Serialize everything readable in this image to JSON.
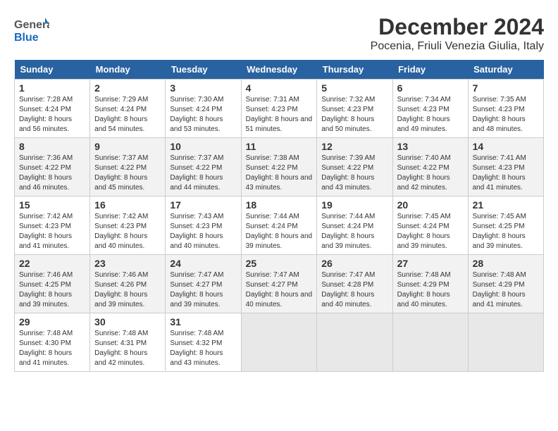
{
  "header": {
    "logo_general": "General",
    "logo_blue": "Blue",
    "month": "December 2024",
    "location": "Pocenia, Friuli Venezia Giulia, Italy"
  },
  "columns": [
    "Sunday",
    "Monday",
    "Tuesday",
    "Wednesday",
    "Thursday",
    "Friday",
    "Saturday"
  ],
  "weeks": [
    [
      {
        "day": "1",
        "sunrise": "Sunrise: 7:28 AM",
        "sunset": "Sunset: 4:24 PM",
        "daylight": "Daylight: 8 hours and 56 minutes."
      },
      {
        "day": "2",
        "sunrise": "Sunrise: 7:29 AM",
        "sunset": "Sunset: 4:24 PM",
        "daylight": "Daylight: 8 hours and 54 minutes."
      },
      {
        "day": "3",
        "sunrise": "Sunrise: 7:30 AM",
        "sunset": "Sunset: 4:24 PM",
        "daylight": "Daylight: 8 hours and 53 minutes."
      },
      {
        "day": "4",
        "sunrise": "Sunrise: 7:31 AM",
        "sunset": "Sunset: 4:23 PM",
        "daylight": "Daylight: 8 hours and 51 minutes."
      },
      {
        "day": "5",
        "sunrise": "Sunrise: 7:32 AM",
        "sunset": "Sunset: 4:23 PM",
        "daylight": "Daylight: 8 hours and 50 minutes."
      },
      {
        "day": "6",
        "sunrise": "Sunrise: 7:34 AM",
        "sunset": "Sunset: 4:23 PM",
        "daylight": "Daylight: 8 hours and 49 minutes."
      },
      {
        "day": "7",
        "sunrise": "Sunrise: 7:35 AM",
        "sunset": "Sunset: 4:23 PM",
        "daylight": "Daylight: 8 hours and 48 minutes."
      }
    ],
    [
      {
        "day": "8",
        "sunrise": "Sunrise: 7:36 AM",
        "sunset": "Sunset: 4:22 PM",
        "daylight": "Daylight: 8 hours and 46 minutes."
      },
      {
        "day": "9",
        "sunrise": "Sunrise: 7:37 AM",
        "sunset": "Sunset: 4:22 PM",
        "daylight": "Daylight: 8 hours and 45 minutes."
      },
      {
        "day": "10",
        "sunrise": "Sunrise: 7:37 AM",
        "sunset": "Sunset: 4:22 PM",
        "daylight": "Daylight: 8 hours and 44 minutes."
      },
      {
        "day": "11",
        "sunrise": "Sunrise: 7:38 AM",
        "sunset": "Sunset: 4:22 PM",
        "daylight": "Daylight: 8 hours and 43 minutes."
      },
      {
        "day": "12",
        "sunrise": "Sunrise: 7:39 AM",
        "sunset": "Sunset: 4:22 PM",
        "daylight": "Daylight: 8 hours and 43 minutes."
      },
      {
        "day": "13",
        "sunrise": "Sunrise: 7:40 AM",
        "sunset": "Sunset: 4:22 PM",
        "daylight": "Daylight: 8 hours and 42 minutes."
      },
      {
        "day": "14",
        "sunrise": "Sunrise: 7:41 AM",
        "sunset": "Sunset: 4:23 PM",
        "daylight": "Daylight: 8 hours and 41 minutes."
      }
    ],
    [
      {
        "day": "15",
        "sunrise": "Sunrise: 7:42 AM",
        "sunset": "Sunset: 4:23 PM",
        "daylight": "Daylight: 8 hours and 41 minutes."
      },
      {
        "day": "16",
        "sunrise": "Sunrise: 7:42 AM",
        "sunset": "Sunset: 4:23 PM",
        "daylight": "Daylight: 8 hours and 40 minutes."
      },
      {
        "day": "17",
        "sunrise": "Sunrise: 7:43 AM",
        "sunset": "Sunset: 4:23 PM",
        "daylight": "Daylight: 8 hours and 40 minutes."
      },
      {
        "day": "18",
        "sunrise": "Sunrise: 7:44 AM",
        "sunset": "Sunset: 4:24 PM",
        "daylight": "Daylight: 8 hours and 39 minutes."
      },
      {
        "day": "19",
        "sunrise": "Sunrise: 7:44 AM",
        "sunset": "Sunset: 4:24 PM",
        "daylight": "Daylight: 8 hours and 39 minutes."
      },
      {
        "day": "20",
        "sunrise": "Sunrise: 7:45 AM",
        "sunset": "Sunset: 4:24 PM",
        "daylight": "Daylight: 8 hours and 39 minutes."
      },
      {
        "day": "21",
        "sunrise": "Sunrise: 7:45 AM",
        "sunset": "Sunset: 4:25 PM",
        "daylight": "Daylight: 8 hours and 39 minutes."
      }
    ],
    [
      {
        "day": "22",
        "sunrise": "Sunrise: 7:46 AM",
        "sunset": "Sunset: 4:25 PM",
        "daylight": "Daylight: 8 hours and 39 minutes."
      },
      {
        "day": "23",
        "sunrise": "Sunrise: 7:46 AM",
        "sunset": "Sunset: 4:26 PM",
        "daylight": "Daylight: 8 hours and 39 minutes."
      },
      {
        "day": "24",
        "sunrise": "Sunrise: 7:47 AM",
        "sunset": "Sunset: 4:27 PM",
        "daylight": "Daylight: 8 hours and 39 minutes."
      },
      {
        "day": "25",
        "sunrise": "Sunrise: 7:47 AM",
        "sunset": "Sunset: 4:27 PM",
        "daylight": "Daylight: 8 hours and 40 minutes."
      },
      {
        "day": "26",
        "sunrise": "Sunrise: 7:47 AM",
        "sunset": "Sunset: 4:28 PM",
        "daylight": "Daylight: 8 hours and 40 minutes."
      },
      {
        "day": "27",
        "sunrise": "Sunrise: 7:48 AM",
        "sunset": "Sunset: 4:29 PM",
        "daylight": "Daylight: 8 hours and 40 minutes."
      },
      {
        "day": "28",
        "sunrise": "Sunrise: 7:48 AM",
        "sunset": "Sunset: 4:29 PM",
        "daylight": "Daylight: 8 hours and 41 minutes."
      }
    ],
    [
      {
        "day": "29",
        "sunrise": "Sunrise: 7:48 AM",
        "sunset": "Sunset: 4:30 PM",
        "daylight": "Daylight: 8 hours and 41 minutes."
      },
      {
        "day": "30",
        "sunrise": "Sunrise: 7:48 AM",
        "sunset": "Sunset: 4:31 PM",
        "daylight": "Daylight: 8 hours and 42 minutes."
      },
      {
        "day": "31",
        "sunrise": "Sunrise: 7:48 AM",
        "sunset": "Sunset: 4:32 PM",
        "daylight": "Daylight: 8 hours and 43 minutes."
      },
      null,
      null,
      null,
      null
    ]
  ]
}
